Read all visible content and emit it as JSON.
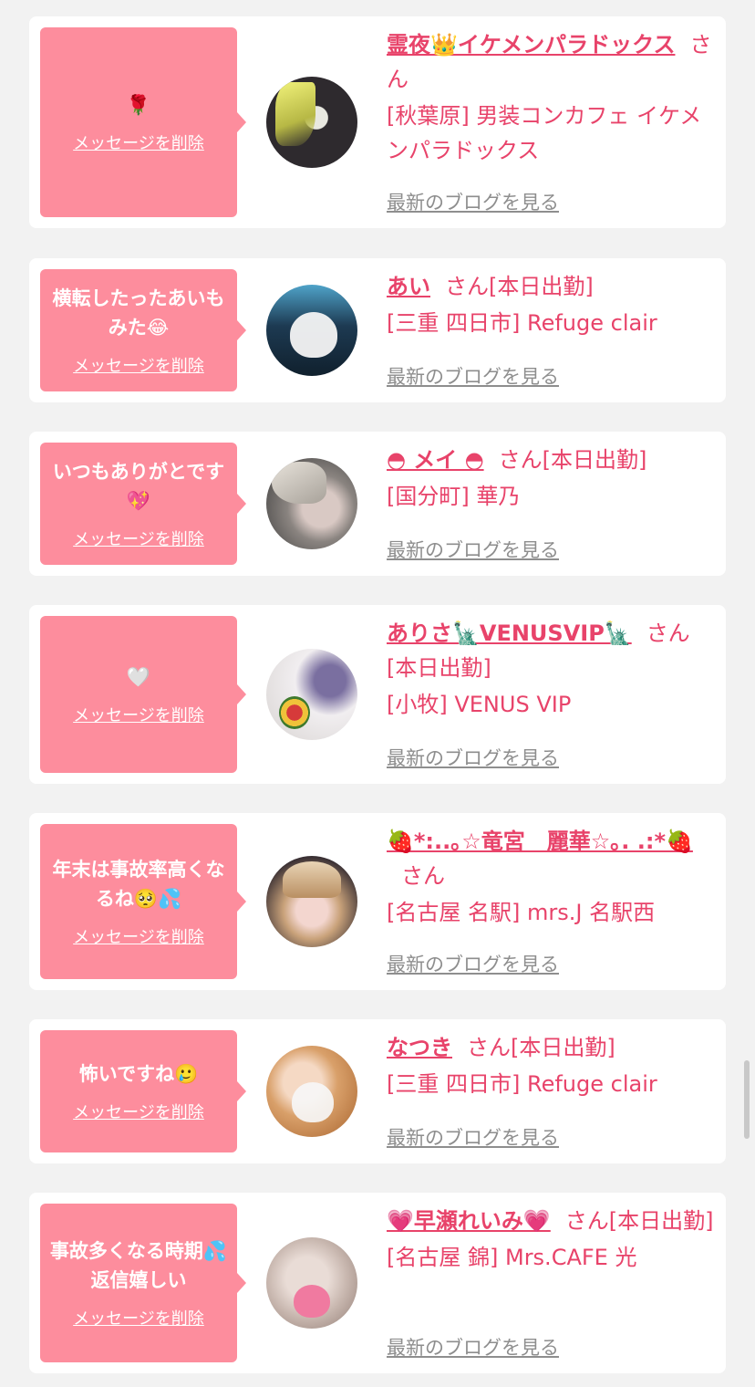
{
  "delete_label": "メッセージを削除",
  "blog_label": "最新のブログを見る",
  "san_label": "さん",
  "colors": {
    "background": "#f2f2f2",
    "bubble": "#fd8d9d",
    "accent": "#e8436a",
    "link_gray": "#8e8e8e"
  },
  "messages": [
    {
      "message": "🌹",
      "name": "霊夜👑イケメンパラドックス",
      "status": "",
      "shop": "[秋葉原] 男装コンカフェ イケメンパラドックス",
      "avatar_icon": "avatar-photo-icon"
    },
    {
      "message": "横転したったあいもみた😂",
      "name": "あい",
      "status": "[本日出勤]",
      "shop": "[三重 四日市] Refuge clair",
      "avatar_icon": "avatar-photo-icon"
    },
    {
      "message": "いつもありがとです💖",
      "name": "◓ メイ ◓",
      "status": "[本日出勤]",
      "shop": "[国分町] 華乃",
      "avatar_icon": "avatar-photo-icon"
    },
    {
      "message": "🤍",
      "name": "ありさ🗽VENUSVIP🗽",
      "status": "[本日出勤]",
      "shop": "[小牧] VENUS VIP",
      "avatar_icon": "avatar-photo-icon"
    },
    {
      "message": "年末は事故率高くなるね🥺💦",
      "name": "🍓*:..｡☆竜宮　麗華☆｡. .:*🍓",
      "status": "",
      "shop": "[名古屋 名駅] mrs.J 名駅西",
      "avatar_icon": "avatar-photo-icon"
    },
    {
      "message": "怖いですね🥲",
      "name": "なつき",
      "status": "[本日出勤]",
      "shop": "[三重 四日市] Refuge clair",
      "avatar_icon": "avatar-photo-icon"
    },
    {
      "message": "事故多くなる時期💦返信嬉しい",
      "name": "💗早瀬れいみ💗",
      "status": "[本日出勤]",
      "shop": "[名古屋 錦] Mrs.CAFE 光",
      "avatar_icon": "avatar-photo-icon"
    }
  ]
}
